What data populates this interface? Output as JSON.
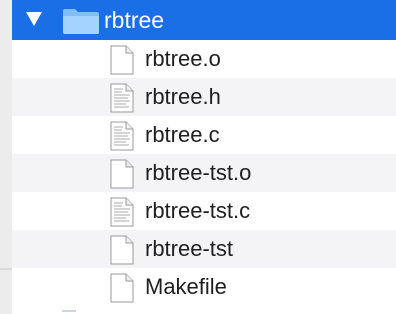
{
  "colors": {
    "selection": "#1a6ee6",
    "folder": "#8cc8ff",
    "alt_row": "#f4f4f6",
    "text": "#1f1f1f"
  },
  "folder": {
    "label": "rbtree",
    "icon": "folder-icon",
    "expanded": true
  },
  "files": [
    {
      "label": "rbtree.o",
      "icon": "blank-file-icon"
    },
    {
      "label": "rbtree.h",
      "icon": "text-file-icon"
    },
    {
      "label": "rbtree.c",
      "icon": "text-file-icon"
    },
    {
      "label": "rbtree-tst.o",
      "icon": "blank-file-icon"
    },
    {
      "label": "rbtree-tst.c",
      "icon": "text-file-icon"
    },
    {
      "label": "rbtree-tst",
      "icon": "blank-file-icon"
    },
    {
      "label": "Makefile",
      "icon": "blank-file-icon"
    }
  ]
}
